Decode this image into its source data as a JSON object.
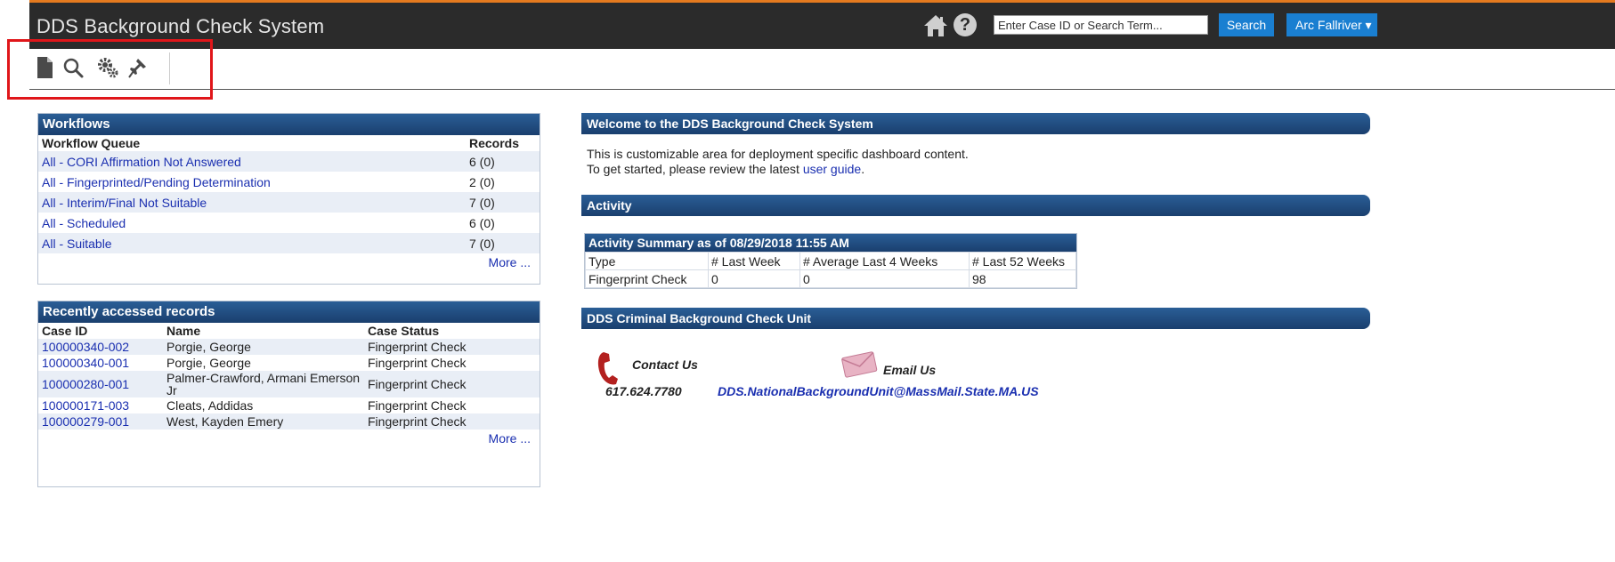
{
  "header": {
    "title": "DDS Background Check System",
    "search_placeholder": "Enter Case ID or Search Term...",
    "search_label": "Search",
    "user_label": "Arc Fallriver ▾"
  },
  "toolbar": {
    "icons": [
      "document-icon",
      "search-icon",
      "gears-icon",
      "pin-icon"
    ]
  },
  "workflows": {
    "title": "Workflows",
    "col_queue": "Workflow Queue",
    "col_records": "Records",
    "rows": [
      {
        "queue": "All - CORI Affirmation Not Answered",
        "records": "6 (0)"
      },
      {
        "queue": "All - Fingerprinted/Pending Determination",
        "records": "2 (0)"
      },
      {
        "queue": "All - Interim/Final Not Suitable",
        "records": "7 (0)"
      },
      {
        "queue": "All - Scheduled",
        "records": "6 (0)"
      },
      {
        "queue": "All - Suitable",
        "records": "7 (0)"
      }
    ],
    "more": "More ..."
  },
  "recent": {
    "title": "Recently accessed records",
    "col_case": "Case ID",
    "col_name": "Name",
    "col_status": "Case Status",
    "rows": [
      {
        "case": "100000340-002",
        "name": "Porgie, George",
        "status": "Fingerprint Check"
      },
      {
        "case": "100000340-001",
        "name": "Porgie, George",
        "status": "Fingerprint Check"
      },
      {
        "case": "100000280-001",
        "name": "Palmer-Crawford, Armani Emerson Jr",
        "status": "Fingerprint Check"
      },
      {
        "case": "100000171-003",
        "name": "Cleats, Addidas",
        "status": "Fingerprint Check"
      },
      {
        "case": "100000279-001",
        "name": "West, Kayden Emery",
        "status": "Fingerprint Check"
      }
    ],
    "more": "More ..."
  },
  "welcome": {
    "title": "Welcome to the DDS Background Check System",
    "line1": "This is customizable area for deployment specific dashboard content.",
    "line2_prefix": "To get started, please review the latest ",
    "line2_link": "user guide",
    "line2_suffix": "."
  },
  "activity": {
    "title": "Activity",
    "summary_title": "Activity Summary as of 08/29/2018 11:55 AM",
    "headers": [
      "Type",
      "# Last Week",
      "# Average Last 4 Weeks",
      "# Last 52 Weeks"
    ],
    "row": [
      "Fingerprint Check",
      "0",
      "0",
      "98"
    ]
  },
  "unit": {
    "title": "DDS Criminal Background Check Unit",
    "contact_label": "Contact Us",
    "phone": "617.624.7780",
    "email_label": "Email Us",
    "email": "DDS.NationalBackgroundUnit@MassMail.State.MA.US"
  },
  "colors": {
    "header_bg": "#2b2b2b",
    "accent_orange": "#e47a1f",
    "panel_blue": "#1a3f6e",
    "button_blue": "#1a7fd1",
    "highlight_red": "#e0161a"
  }
}
